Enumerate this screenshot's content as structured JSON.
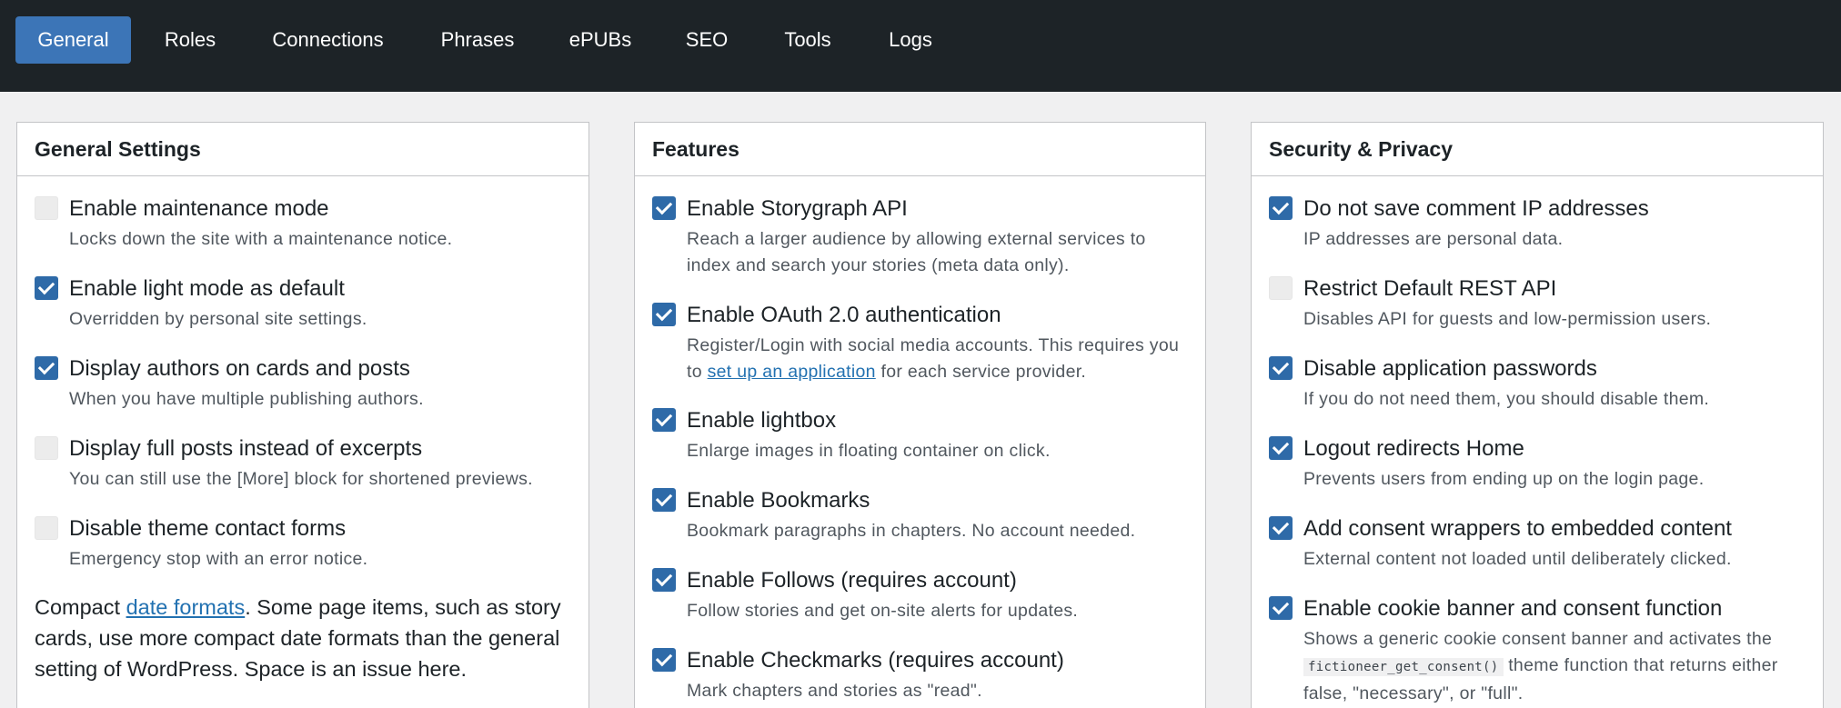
{
  "nav": {
    "tabs": [
      {
        "label": "General",
        "active": true
      },
      {
        "label": "Roles"
      },
      {
        "label": "Connections"
      },
      {
        "label": "Phrases"
      },
      {
        "label": "ePUBs"
      },
      {
        "label": "SEO"
      },
      {
        "label": "Tools"
      },
      {
        "label": "Logs"
      }
    ]
  },
  "general": {
    "title": "General Settings",
    "options": [
      {
        "label": "Enable maintenance mode",
        "desc": "Locks down the site with a maintenance notice.",
        "checked": false
      },
      {
        "label": "Enable light mode as default",
        "desc": "Overridden by personal site settings.",
        "checked": true
      },
      {
        "label": "Display authors on cards and posts",
        "desc": "When you have multiple publishing authors.",
        "checked": true
      },
      {
        "label": "Display full posts instead of excerpts",
        "desc": "You can still use the [More] block for shortened previews.",
        "checked": false
      },
      {
        "label": "Disable theme contact forms",
        "desc": "Emergency stop with an error notice.",
        "checked": false
      }
    ],
    "date_note": {
      "prefix": "Compact ",
      "link": "date formats",
      "suffix": ". Some page items, such as story cards, use more compact date formats than the general setting of WordPress. Space is an issue here."
    }
  },
  "features": {
    "title": "Features",
    "options": [
      {
        "label": "Enable Storygraph API",
        "desc": "Reach a larger audience by allowing external services to index and search your stories (meta data only).",
        "checked": true
      },
      {
        "label": "Enable OAuth 2.0 authentication",
        "desc_prefix": "Register/Login with social media accounts. This requires you to ",
        "desc_link": "set up an application",
        "desc_suffix": " for each service provider.",
        "checked": true
      },
      {
        "label": "Enable lightbox",
        "desc": "Enlarge images in floating container on click.",
        "checked": true
      },
      {
        "label": "Enable Bookmarks",
        "desc": "Bookmark paragraphs in chapters. No account needed.",
        "checked": true
      },
      {
        "label": "Enable Follows (requires account)",
        "desc": "Follow stories and get on-site alerts for updates.",
        "checked": true
      },
      {
        "label": "Enable Checkmarks (requires account)",
        "desc": "Mark chapters and stories as \"read\".",
        "checked": true
      }
    ]
  },
  "security": {
    "title": "Security & Privacy",
    "options": [
      {
        "label": "Do not save comment IP addresses",
        "desc": "IP addresses are personal data.",
        "checked": true
      },
      {
        "label": "Restrict Default REST API",
        "desc": "Disables API for guests and low-permission users.",
        "checked": false
      },
      {
        "label": "Disable application passwords",
        "desc": "If you do not need them, you should disable them.",
        "checked": true
      },
      {
        "label": "Logout redirects Home",
        "desc": "Prevents users from ending up on the login page.",
        "checked": true
      },
      {
        "label": "Add consent wrappers to embedded content",
        "desc": "External content not loaded until deliberately clicked.",
        "checked": true
      },
      {
        "label": "Enable cookie banner and consent function",
        "desc_prefix": "Shows a generic cookie consent banner and activates the ",
        "desc_code": "fictioneer_get_consent()",
        "desc_suffix": " theme function that returns either false, \"necessary\", or \"full\".",
        "checked": true
      }
    ]
  },
  "colors": {
    "nav_bg": "#1d2327",
    "tab_active": "#3c75b7",
    "checkbox_on": "#2e6aa8",
    "link": "#2271b1"
  }
}
